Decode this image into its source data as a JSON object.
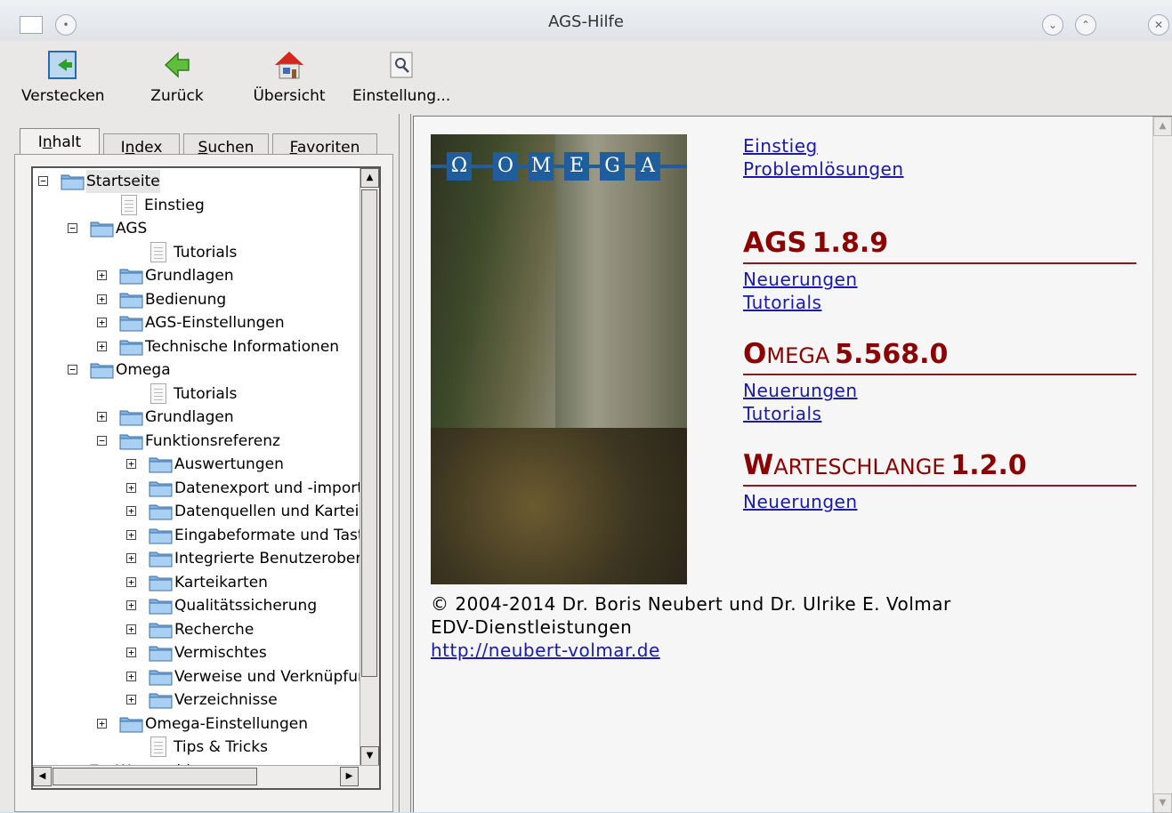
{
  "window": {
    "title": "AGS-Hilfe"
  },
  "toolbar": {
    "hide": "Verstecken",
    "back": "Zurück",
    "overview": "Übersicht",
    "settings": "Einstellung..."
  },
  "tabs": {
    "contents_pre": "I",
    "contents_mn": "n",
    "contents_post": "halt",
    "index_pre": "I",
    "index_mn": "n",
    "index_post": "dex",
    "search_mn": "S",
    "search_post": "uchen",
    "favorites_mn": "F",
    "favorites_post": "avoriten"
  },
  "tree": {
    "nodes": [
      "Startseite",
      "Einstieg",
      "AGS",
      "Tutorials",
      "Grundlagen",
      "Bedienung",
      "AGS-Einstellungen",
      "Technische Informationen",
      "Omega",
      "Tutorials",
      "Grundlagen",
      "Funktionsreferenz",
      "Auswertungen",
      "Datenexport und -import",
      "Datenquellen und Karteie",
      "Eingabeformate und Tast",
      "Integrierte Benutzerober",
      "Karteikarten",
      "Qualitätssicherung",
      "Recherche",
      "Vermischtes",
      "Verweise und Verknüpfur",
      "Verzeichnisse",
      "Omega-Einstellungen",
      "Tips & Tricks",
      "Warteschlange"
    ]
  },
  "content": {
    "logo": [
      "Ω",
      "O",
      "M",
      "E",
      "G",
      "A"
    ],
    "links_top": [
      "Einstieg",
      "Problemlösungen"
    ],
    "ags": {
      "name": "AGS",
      "version": "1.8.9",
      "links": [
        "Neuerungen",
        "Tutorials"
      ]
    },
    "omega": {
      "name_first": "O",
      "name_rest": "MEGA",
      "version": "5.568.0",
      "links": [
        "Neuerungen",
        "Tutorials"
      ]
    },
    "queue": {
      "name_first": "W",
      "name_rest": "ARTESCHLANGE",
      "version": "1.2.0",
      "links": [
        "Neuerungen"
      ]
    },
    "footer": {
      "copyright": "© 2004-2014 Dr. Boris Neubert und Dr. Ulrike E. Volmar",
      "company": "EDV-Dienstleistungen",
      "url": "http://neubert-volmar.de"
    }
  },
  "colors": {
    "heading": "#8b0000",
    "link": "#1a1aa8",
    "logo_blue": "#1f5e9a"
  }
}
